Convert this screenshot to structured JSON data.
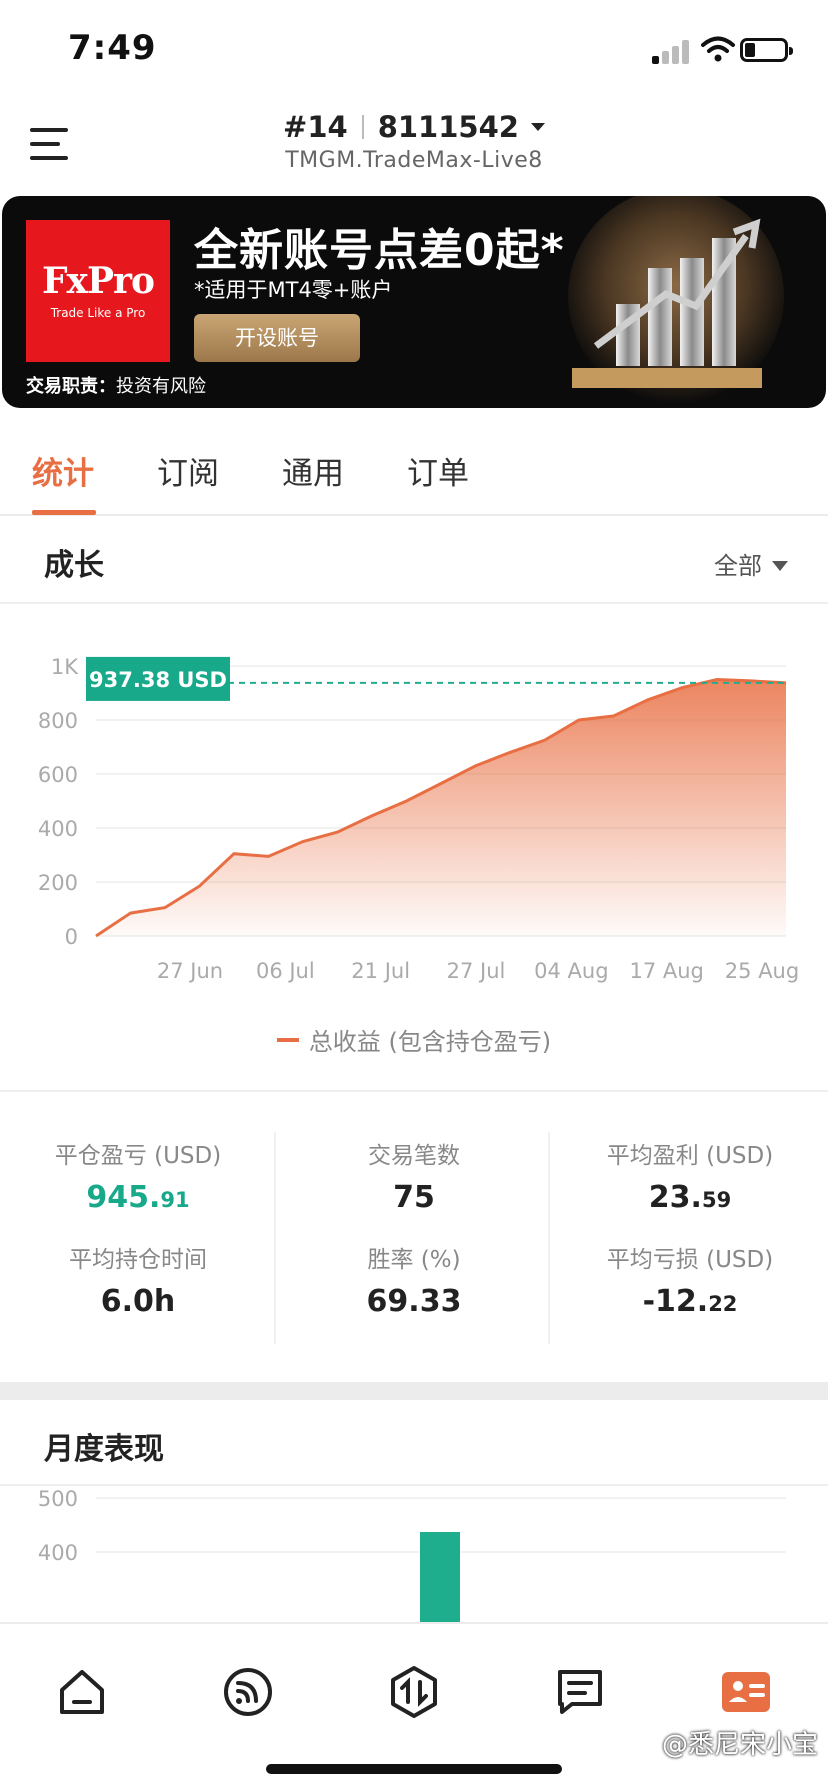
{
  "status_bar": {
    "time": "7:49"
  },
  "header": {
    "account_rank": "#14",
    "account_number": "8111542",
    "server": "TMGM.TradeMax-Live8"
  },
  "banner": {
    "brand": "FxPro",
    "brand_tagline": "Trade Like a Pro",
    "headline": "全新账号点差0起*",
    "subline": "*适用于MT4零+账户",
    "cta": "开设账号",
    "risk_label": "交易职责：",
    "risk_text": "投资有风险"
  },
  "tabs": [
    {
      "label": "统计",
      "active": true
    },
    {
      "label": "订阅",
      "active": false
    },
    {
      "label": "通用",
      "active": false
    },
    {
      "label": "订单",
      "active": false
    }
  ],
  "growth": {
    "title": "成长",
    "period": "全部",
    "current_label": "937.38 USD",
    "legend": "总收益 (包含持仓盈亏)"
  },
  "chart_data": [
    {
      "type": "area",
      "title": "成长",
      "xlabel": "",
      "ylabel": "",
      "ylim": [
        0,
        1000
      ],
      "y_ticks": [
        "0",
        "200",
        "400",
        "600",
        "800",
        "1K"
      ],
      "x_ticks": [
        "27 Jun",
        "06 Jul",
        "21 Jul",
        "27 Jul",
        "04 Aug",
        "17 Aug",
        "25 Aug"
      ],
      "grid": true,
      "series": [
        {
          "name": "总收益 (包含持仓盈亏)",
          "color": "#e86f43",
          "x": [
            0,
            0.05,
            0.1,
            0.15,
            0.2,
            0.25,
            0.3,
            0.35,
            0.4,
            0.45,
            0.5,
            0.55,
            0.6,
            0.65,
            0.7,
            0.75,
            0.8,
            0.85,
            0.9,
            0.95,
            1.0
          ],
          "values": [
            0,
            85,
            105,
            185,
            305,
            295,
            350,
            385,
            445,
            500,
            565,
            630,
            680,
            725,
            800,
            815,
            875,
            920,
            950,
            945,
            937.38
          ]
        }
      ],
      "reference_line": 937.38
    },
    {
      "type": "bar",
      "title": "月度表现",
      "y_ticks": [
        "400",
        "500"
      ],
      "visible_bar_color": "#1fae8d"
    }
  ],
  "stats": {
    "closed_pl_label": "平仓盈亏 (USD)",
    "closed_pl_int": "945.",
    "closed_pl_dec": "91",
    "trades_label": "交易笔数",
    "trades_value": "75",
    "avg_profit_label": "平均盈利 (USD)",
    "avg_profit_int": "23.",
    "avg_profit_dec": "59",
    "avg_hold_label": "平均持仓时间",
    "avg_hold_value": "6.0h",
    "win_rate_label": "胜率 (%)",
    "win_rate_value": "69.33",
    "avg_loss_label": "平均亏损 (USD)",
    "avg_loss_int": "-12.",
    "avg_loss_dec": "22"
  },
  "monthly": {
    "title": "月度表现"
  },
  "nav": [
    "home-icon",
    "feed-icon",
    "trade-icon",
    "news-icon",
    "profile-icon"
  ],
  "watermark": "@悉尼宋小宝",
  "colors": {
    "accent": "#e86f43",
    "positive": "#18a88a",
    "bar": "#1fae8d"
  }
}
